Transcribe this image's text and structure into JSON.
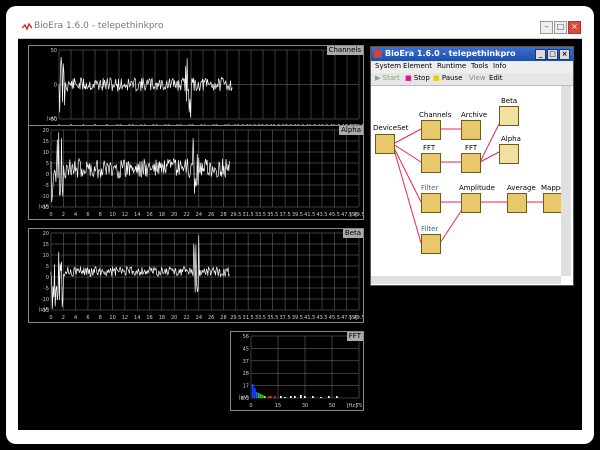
{
  "window": {
    "title": "BioEra 1.6.0 - telepethinkpro"
  },
  "plots": {
    "channels": {
      "label": "Channels",
      "yticks": [
        "50",
        "0",
        "-50",
        "(uV)"
      ],
      "xticks": [
        "0",
        "2",
        "4",
        "6",
        "8",
        "10",
        "12",
        "14",
        "16",
        "18",
        "20",
        "22",
        "24",
        "26",
        "28",
        "29.5",
        "31.5",
        "33.5",
        "35.5",
        "37.5",
        "39.5",
        "41.5",
        "43.5",
        "45.5",
        "47.5",
        "49.5",
        "[S]"
      ]
    },
    "alpha": {
      "label": "Alpha",
      "yticks": [
        "20",
        "15",
        "10",
        "5",
        "0",
        "-5",
        "-10",
        "-15",
        "(uV)"
      ],
      "xticks": [
        "0",
        "2",
        "4",
        "6",
        "8",
        "10",
        "12",
        "14",
        "16",
        "18",
        "20",
        "22",
        "24",
        "26",
        "28",
        "29.5",
        "31.5",
        "33.5",
        "35.5",
        "37.5",
        "39.5",
        "41.5",
        "43.5",
        "45.5",
        "47.5",
        "49.5",
        "[S]"
      ]
    },
    "beta": {
      "label": "Beta",
      "yticks": [
        "20",
        "15",
        "10",
        "5",
        "0",
        "-5",
        "-10",
        "-15",
        "(uV)"
      ],
      "xticks": [
        "0",
        "2",
        "4",
        "6",
        "8",
        "10",
        "12",
        "14",
        "16",
        "18",
        "20",
        "22",
        "24",
        "26",
        "28",
        "29.5",
        "31.5",
        "33.5",
        "35.5",
        "37.5",
        "39.5",
        "41.5",
        "43.5",
        "45.5",
        "47.5",
        "49.5",
        "[S]"
      ]
    },
    "fft": {
      "label": "FFT",
      "yticks": [
        "56",
        "45",
        "37",
        "28",
        "17",
        "8.5",
        "(uV)"
      ],
      "xticks": [
        "0",
        "15",
        "30",
        "50",
        "75",
        "[Hz]"
      ]
    }
  },
  "inner": {
    "title": "BioEra 1.6.0 - telepethinkpro",
    "menu": [
      "System",
      "Element",
      "Runtime",
      "Tools",
      "Info"
    ],
    "toolbar": {
      "start": "Start",
      "stop": "Stop",
      "pause": "Pause",
      "view": "View",
      "edit": "Edit"
    },
    "nodes": {
      "deviceset": "DeviceSet",
      "channels": "Channels",
      "archive": "Archive",
      "beta": "Beta",
      "fft1": "FFT",
      "fft2": "FFT",
      "alpha": "Alpha",
      "filter1": "Filter",
      "amplitude": "Amplitude",
      "average": "Average",
      "mapper": "Mapper",
      "filter2": "Filter"
    }
  }
}
